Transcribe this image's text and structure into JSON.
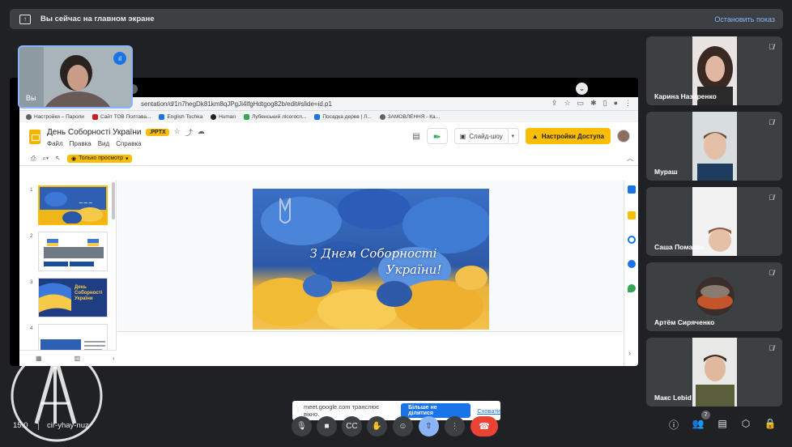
{
  "banner": {
    "text": "Вы сейчас на главном экране",
    "stop_label": "Остановить показ"
  },
  "browser": {
    "url": "sentation/d/1n7hegDk81km8qJPgJi4lfgHdtgog82b/edit#slide=id.p1",
    "bookmarks": [
      {
        "label": "Настройки – Пароли",
        "color": "#5f6368"
      },
      {
        "label": "Сайт ТОВ Полтава...",
        "color": "#c5221f"
      },
      {
        "label": "English Tochka",
        "color": "#1a73e8"
      },
      {
        "label": "Human",
        "color": "#202124"
      },
      {
        "label": "Лубенський лісогосп...",
        "color": "#34a853"
      },
      {
        "label": "Посадка дерев | Л...",
        "color": "#1a73e8"
      },
      {
        "label": "ЗАМОВЛЕННЯ - Ка...",
        "color": "#5f6368"
      }
    ]
  },
  "doc": {
    "title": "День Соборності України",
    "badge": ".PPTX",
    "menu": [
      "Файл",
      "Правка",
      "Вид",
      "Справка"
    ],
    "slideshow_label": "Слайд-шоу",
    "share_label": "Настройки Доступа",
    "view_only_label": "Только просмотр"
  },
  "slides": {
    "numbers": [
      "1",
      "2",
      "3",
      "4"
    ],
    "slide3_title": "День Соборності України",
    "main_text_line1": "З Днем Соборності",
    "main_text_line2": "України!"
  },
  "self_view": {
    "name": "Вы"
  },
  "participants": [
    {
      "name": "Карина Назаренко"
    },
    {
      "name": "Мураш"
    },
    {
      "name": "Саша Помазан"
    },
    {
      "name": "Артём Сиряченко"
    },
    {
      "name": "Макс Lebid"
    }
  ],
  "notice": {
    "message": "meet.google.com транслює вікно.",
    "stop_label": "Більше не ділитися",
    "hide_label": "Сховати"
  },
  "meeting": {
    "time": "15:0",
    "code": "cir-yhay-nuz",
    "participant_count": "7"
  },
  "colors": {
    "background": "#202124",
    "accent_blue": "#8ab4f8",
    "hangup_red": "#ea4335",
    "slides_yellow": "#fbbc04"
  }
}
